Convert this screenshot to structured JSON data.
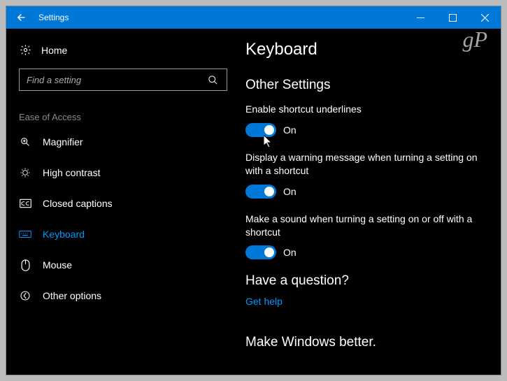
{
  "titlebar": {
    "title": "Settings"
  },
  "sidebar": {
    "home_label": "Home",
    "search_placeholder": "Find a setting",
    "section_label": "Ease of Access",
    "items": [
      {
        "label": "Magnifier"
      },
      {
        "label": "High contrast"
      },
      {
        "label": "Closed captions"
      },
      {
        "label": "Keyboard"
      },
      {
        "label": "Mouse"
      },
      {
        "label": "Other options"
      }
    ]
  },
  "main": {
    "page_title": "Keyboard",
    "section_title": "Other Settings",
    "settings": [
      {
        "label": "Enable shortcut underlines",
        "state": "On"
      },
      {
        "label": "Display a warning message when turning a setting on with a shortcut",
        "state": "On"
      },
      {
        "label": "Make a sound when turning a setting on or off with a shortcut",
        "state": "On"
      }
    ],
    "question_title": "Have a question?",
    "help_link": "Get help",
    "feedback_title": "Make Windows better."
  },
  "watermark": "gP"
}
